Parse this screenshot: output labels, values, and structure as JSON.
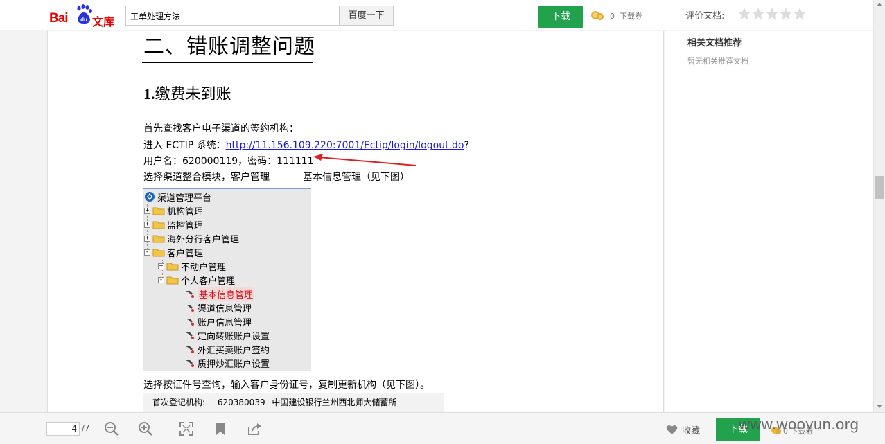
{
  "header": {
    "logo_text_bai": "Bai",
    "logo_text_du": "du",
    "logo_text_wenku": "文库",
    "search_value": "工单处理方法",
    "search_button": "百度一下",
    "download_button": "下载",
    "voucher_count": "0",
    "voucher_label": "下载券",
    "rate_label": "评价文档:"
  },
  "document": {
    "heading1": "二、错账调整问题",
    "heading2_number": "1.",
    "heading2_text": "缴费未到账",
    "para1": "首先查找客户电子渠道的签约机构：",
    "para2_prefix": "进入 ECTIP 系统：",
    "para2_link": "http://11.156.109.220:7001/Ectip/login/logout.do",
    "para2_suffix": "?",
    "para3": "用户名：620000119，密码：111111",
    "para4_a": "选择渠道整合模块，客户管理",
    "para4_b": "基本信息管理（见下图）",
    "tree": {
      "root": "渠道管理平台",
      "items": [
        {
          "label": "机构管理",
          "toggle": "+"
        },
        {
          "label": "监控管理",
          "toggle": "+"
        },
        {
          "label": "海外分行客户管理",
          "toggle": "+"
        },
        {
          "label": "客户管理",
          "toggle": "-"
        },
        {
          "label": "不动户管理",
          "toggle": "+"
        },
        {
          "label": "个人客户管理",
          "toggle": "-"
        },
        {
          "label": "基本信息管理"
        },
        {
          "label": "渠道信息管理"
        },
        {
          "label": "账户信息管理"
        },
        {
          "label": "定向转账账户设置"
        },
        {
          "label": "外汇买卖账户签约"
        },
        {
          "label": "质押炒汇账户设置"
        }
      ]
    },
    "para5": "选择按证件号查询，输入客户身份证号，复制更新机构（见下图）。",
    "form_label": "首次登记机构:",
    "form_code": "620380039",
    "form_name": "中国建设银行兰州西北师大储蓄所"
  },
  "sidebar": {
    "title": "相关文档推荐",
    "empty": "暂无相关推荐文档"
  },
  "bottom": {
    "page_current": "4",
    "page_total": "/7",
    "favorite": "收藏",
    "download_button": "下载",
    "voucher_count": "0",
    "voucher_label": "下载券",
    "watermark": "www.wooyun.org"
  },
  "colors": {
    "brand_red": "#e10602",
    "download_green": "#23a24d",
    "link_blue": "#1a1ad8",
    "selected_red": "#d2131a"
  }
}
